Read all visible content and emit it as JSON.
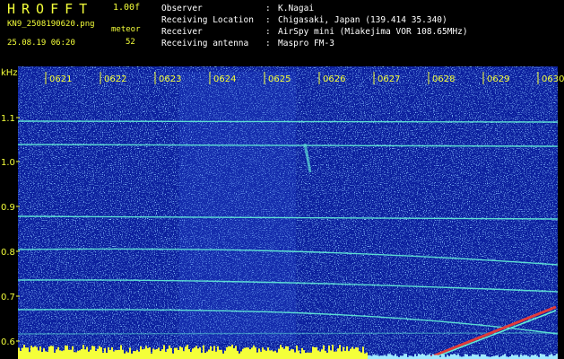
{
  "header": {
    "title": "HROFFT",
    "version": "1.00f",
    "filename": "KN9_2508190620.png",
    "datetime": "25.08.19 06:20",
    "meteor_label": "meteor",
    "meteor_count": "52"
  },
  "info": [
    {
      "label": "Observer",
      "value": "K.Nagai"
    },
    {
      "label": "Receiving Location",
      "value": "Chigasaki, Japan (139.414 35.340)"
    },
    {
      "label": "Receiver",
      "value": "AirSpy mini (Miakejima VOR 108.65MHz)"
    },
    {
      "label": "Receiving antenna",
      "value": "Maspro FM-3"
    }
  ],
  "spectrogram": {
    "unit": "kHz",
    "y_ticks": [
      "1.1",
      "1.0",
      "0.9",
      "0.8",
      "0.7",
      "0.6"
    ],
    "x_ticks": [
      "0621",
      "0622",
      "0623",
      "0624",
      "0625",
      "0626",
      "0627",
      "0628",
      "0629",
      "0630"
    ],
    "colors": {
      "background": "#0b1f9e",
      "noise": "#3a7bff",
      "trace": "#63f0d8",
      "strong": "#e03a3a",
      "text": "#f4ff3a"
    }
  }
}
